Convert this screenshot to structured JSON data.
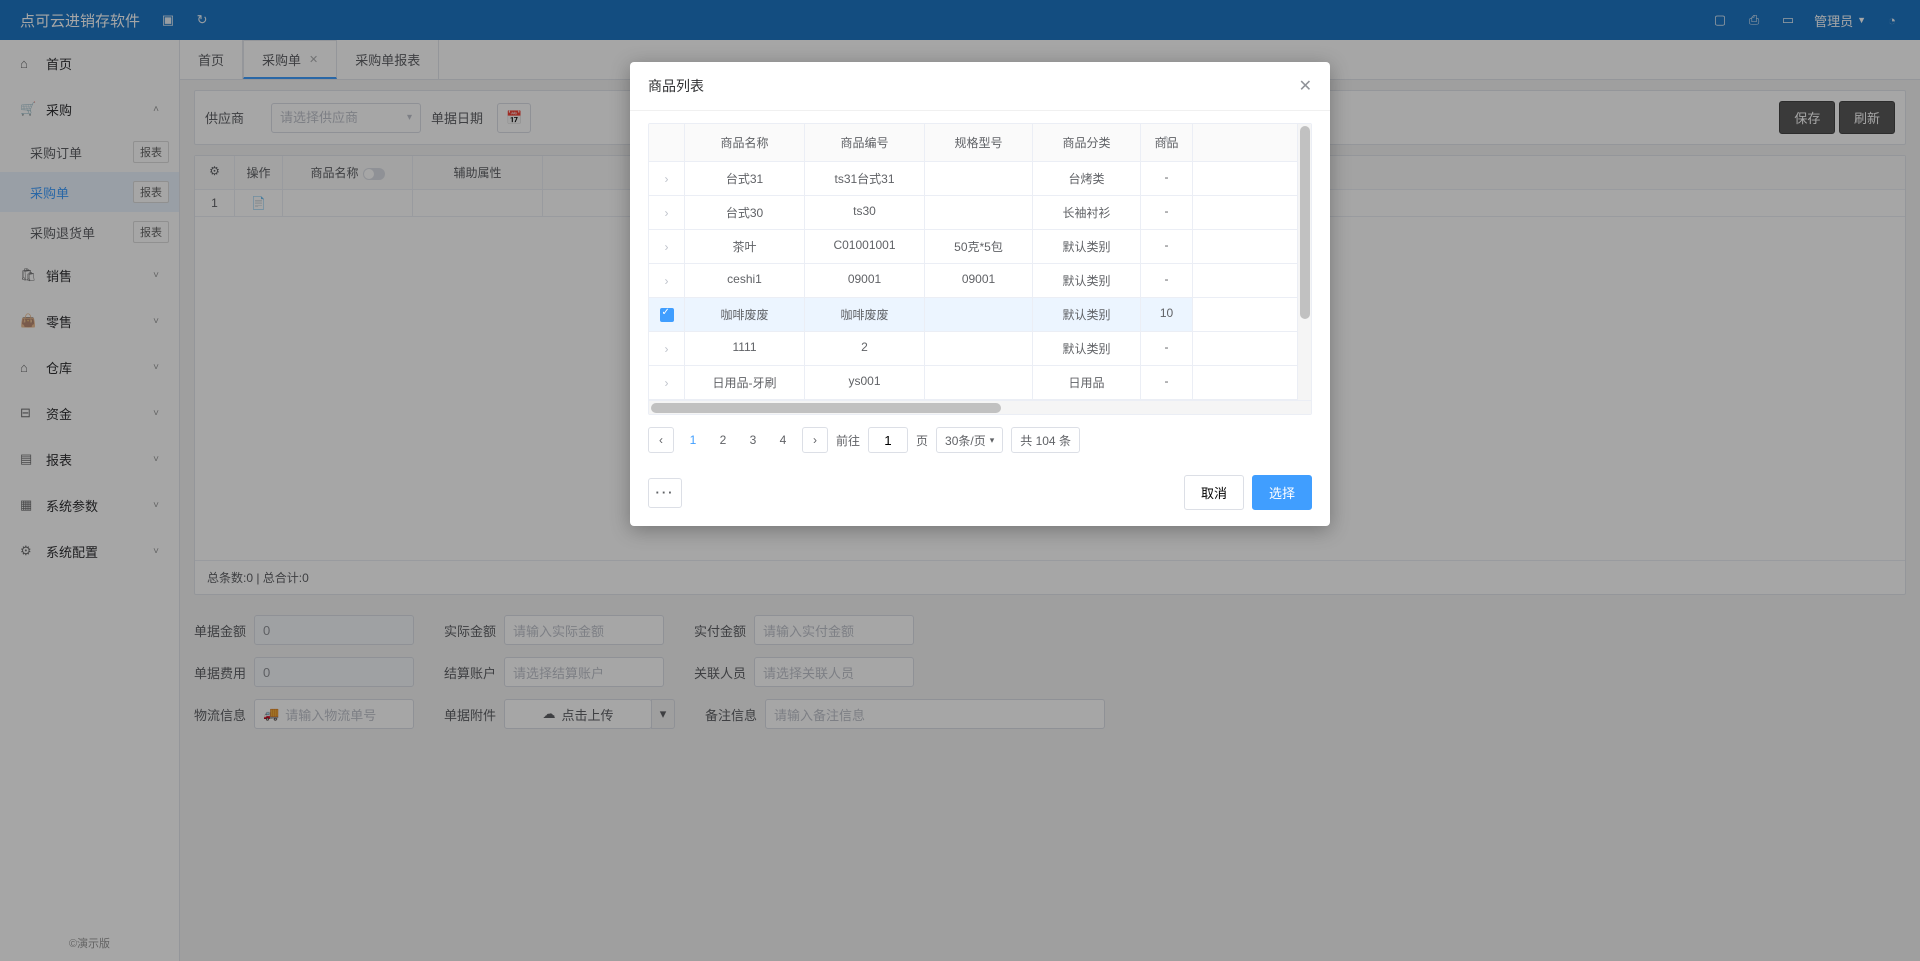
{
  "header": {
    "app_title": "点可云进销存软件",
    "admin": "管理员"
  },
  "sidebar": {
    "items": [
      {
        "label": "首页",
        "icon": "home"
      },
      {
        "label": "采购",
        "icon": "cart",
        "expanded": true,
        "children": [
          {
            "label": "采购订单",
            "badge": "报表"
          },
          {
            "label": "采购单",
            "badge": "报表",
            "active": true
          },
          {
            "label": "采购退货单",
            "badge": "报表"
          }
        ]
      },
      {
        "label": "销售",
        "icon": "cart2"
      },
      {
        "label": "零售",
        "icon": "bag"
      },
      {
        "label": "仓库",
        "icon": "warehouse"
      },
      {
        "label": "资金",
        "icon": "money"
      },
      {
        "label": "报表",
        "icon": "report"
      },
      {
        "label": "系统参数",
        "icon": "grid"
      },
      {
        "label": "系统配置",
        "icon": "gear"
      }
    ],
    "footer": "©演示版"
  },
  "tabs": [
    {
      "label": "首页"
    },
    {
      "label": "采购单",
      "active": true,
      "closable": true
    },
    {
      "label": "采购单报表"
    }
  ],
  "form_bar": {
    "supplier_label": "供应商",
    "supplier_ph": "请选择供应商",
    "date_label": "单据日期",
    "save": "保存",
    "refresh": "刷新"
  },
  "grid": {
    "headers": {
      "op": "操作",
      "name": "商品名称",
      "attr": "辅助属性"
    },
    "row1_idx": "1",
    "footer": "总条数:0 | 总合计:0"
  },
  "bottom": {
    "amount_label": "单据金额",
    "amount_val": "0",
    "actual_label": "实际金额",
    "actual_ph": "请输入实际金额",
    "paid_label": "实付金额",
    "paid_ph": "请输入实付金额",
    "fee_label": "单据费用",
    "fee_val": "0",
    "account_label": "结算账户",
    "account_ph": "请选择结算账户",
    "person_label": "关联人员",
    "person_ph": "请选择关联人员",
    "logistics_label": "物流信息",
    "logistics_ph": "请输入物流单号",
    "attach_label": "单据附件",
    "upload": "点击上传",
    "remark_label": "备注信息",
    "remark_ph": "请输入备注信息"
  },
  "modal": {
    "title": "商品列表",
    "columns": {
      "name": "商品名称",
      "code": "商品编号",
      "spec": "规格型号",
      "cat": "商品分类",
      "last": "商品"
    },
    "rows": [
      {
        "name": "台式31",
        "code": "ts31台式31",
        "spec": "",
        "cat": "台烤类",
        "last": "-"
      },
      {
        "name": "台式30",
        "code": "ts30",
        "spec": "",
        "cat": "长袖衬衫",
        "last": "-"
      },
      {
        "name": "茶叶",
        "code": "C01001001",
        "spec": "50克*5包",
        "cat": "默认类别",
        "last": "-"
      },
      {
        "name": "ceshi1",
        "code": "09001",
        "spec": "09001",
        "cat": "默认类别",
        "last": "-"
      },
      {
        "name": "咖啡废废",
        "code": "咖啡废废",
        "spec": "",
        "cat": "默认类别",
        "last": "10",
        "checked": true
      },
      {
        "name": "1111",
        "code": "2",
        "spec": "",
        "cat": "默认类别",
        "last": "-"
      },
      {
        "name": "日用品-牙刷",
        "code": "ys001",
        "spec": "",
        "cat": "日用品",
        "last": "-"
      }
    ],
    "pager": {
      "pages": [
        "1",
        "2",
        "3",
        "4"
      ],
      "current": "1",
      "goto_label": "前往",
      "goto_val": "1",
      "page_suffix": "页",
      "size": "30条/页",
      "total": "共 104 条"
    },
    "cancel": "取消",
    "select": "选择"
  }
}
